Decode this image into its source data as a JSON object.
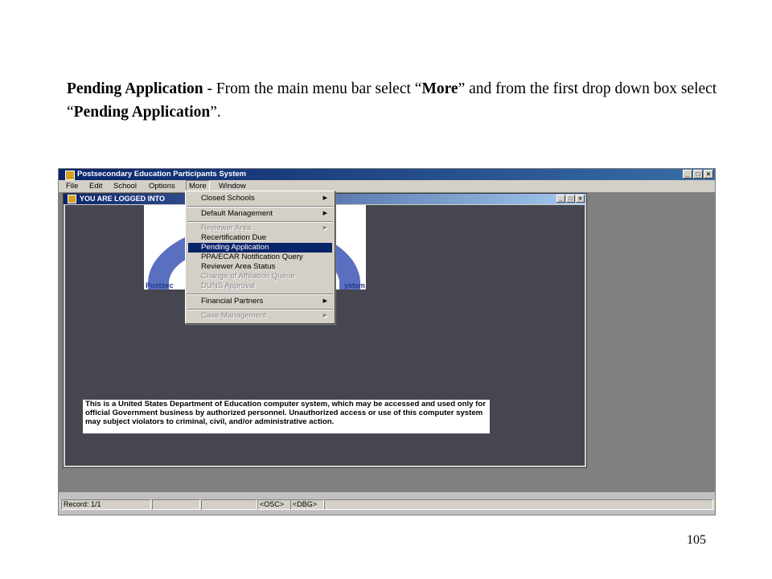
{
  "slide": {
    "heading_bold": "Pending Application",
    "text_1": " - From the main menu bar select “",
    "more_bold": "More",
    "text_2": "” and from the first drop down box select “",
    "pending_bold": "Pending Application",
    "text_3": "”.",
    "page_number": "105"
  },
  "app": {
    "title": "Postsecondary Education Participants System",
    "min_btn": "_",
    "max_btn": "□",
    "close_btn": "×",
    "menu": [
      "File",
      "Edit",
      "School",
      "Options",
      "More",
      "Window"
    ],
    "active_menu": "More"
  },
  "child_window": {
    "title": "YOU ARE LOGGED INTO",
    "logo_left": "Postsec",
    "logo_right": "ystem"
  },
  "dropdown": {
    "items": [
      {
        "label": "Closed Schools",
        "arrow": "▶",
        "state": "normal"
      },
      {
        "label": "Default Management",
        "arrow": "▶",
        "state": "normal"
      },
      {
        "label": "Reviewer Area",
        "arrow": "▶",
        "state": "disabled"
      },
      {
        "label": "Recertification Due",
        "arrow": "",
        "state": "normal"
      },
      {
        "label": "Pending Application",
        "arrow": "",
        "state": "selected"
      },
      {
        "label": "PPA/ECAR Notification Query",
        "arrow": "",
        "state": "normal"
      },
      {
        "label": "Reviewer Area Status",
        "arrow": "",
        "state": "normal"
      },
      {
        "label": "Change of Affiliation Queue",
        "arrow": "",
        "state": "disabled"
      },
      {
        "label": "DUNS Approval",
        "arrow": "",
        "state": "disabled"
      },
      {
        "label": "Financial Partners",
        "arrow": "▶",
        "state": "normal"
      },
      {
        "label": "Case Management",
        "arrow": "▶",
        "state": "disabled"
      }
    ]
  },
  "warning": "This is a United States Department of Education computer system, which may be accessed and used only for official Government business by authorized personnel. Unauthorized access or use of this computer system may subject violators to criminal, civil, and/or administrative action.",
  "statusbar": {
    "record": "Record: 1/1",
    "osc": "<OSC>",
    "dbg": "<DBG>"
  },
  "colors": {
    "titlebar": "#0a246a",
    "mdi_background": "#464650",
    "menu_highlight": "#0a246a",
    "logo_arch": "#5a6fc0"
  }
}
